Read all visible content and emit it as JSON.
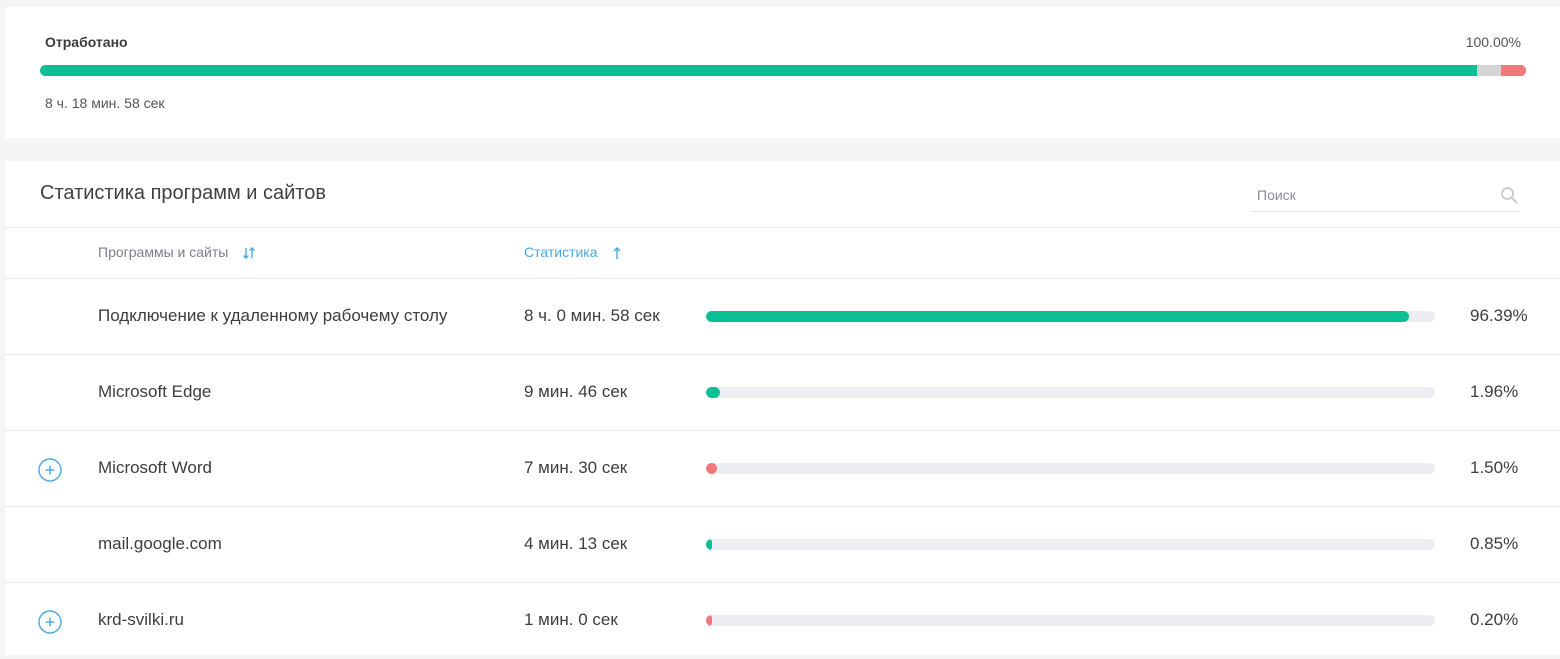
{
  "summary": {
    "label": "Отработано",
    "percent": "100.00%",
    "time": "8 ч. 18 мин. 58 сек",
    "segments": [
      {
        "share": 0.967,
        "color": "#0cbf94"
      },
      {
        "share": 0.016,
        "color": "#d4d4d4"
      },
      {
        "share": 0.017,
        "color": "#f0797b"
      }
    ]
  },
  "stats": {
    "title": "Статистика программ и сайтов",
    "search_placeholder": "Поиск",
    "columns": {
      "programs": "Программы и сайты",
      "statistics": "Статистика"
    },
    "rows": [
      {
        "name": "Подключение к удаленному рабочему столу",
        "time": "8 ч. 0 мин. 58 сек",
        "percent": "96.39%",
        "fraction": 0.9639,
        "color": "#0cbf94",
        "expandable": false
      },
      {
        "name": "Microsoft Edge",
        "time": "9 мин. 46 сек",
        "percent": "1.96%",
        "fraction": 0.0196,
        "color": "#0cbf94",
        "expandable": false
      },
      {
        "name": "Microsoft Word",
        "time": "7 мин. 30 сек",
        "percent": "1.50%",
        "fraction": 0.015,
        "color": "#f0797b",
        "expandable": true
      },
      {
        "name": "mail.google.com",
        "time": "4 мин. 13 сек",
        "percent": "0.85%",
        "fraction": 0.0085,
        "color": "#0cbf94",
        "expandable": false
      },
      {
        "name": "krd-svilki.ru",
        "time": "1 мин. 0 сек",
        "percent": "0.20%",
        "fraction": 0.002,
        "color": "#f0797b",
        "expandable": true
      }
    ]
  },
  "colors": {
    "accent_green": "#0cbf94",
    "accent_red": "#f0797b",
    "link_blue": "#4aa8e6"
  }
}
